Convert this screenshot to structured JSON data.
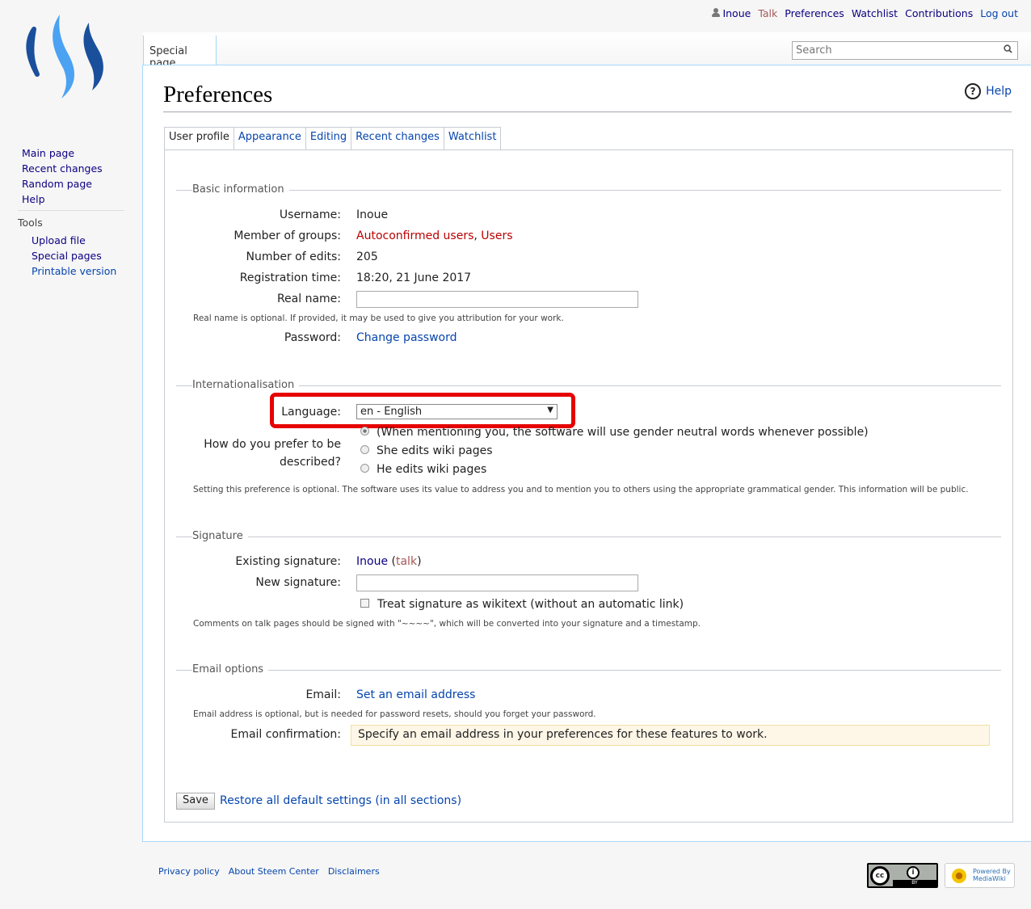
{
  "personal": {
    "username": "Inoue",
    "talk": "Talk",
    "preferences": "Preferences",
    "watchlist": "Watchlist",
    "contributions": "Contributions",
    "logout": "Log out"
  },
  "header": {
    "namespace_tab": "Special page",
    "search_placeholder": "Search"
  },
  "sidebar": {
    "nav": [
      "Main page",
      "Recent changes",
      "Random page",
      "Help"
    ],
    "tools_heading": "Tools",
    "tools": [
      "Upload file",
      "Special pages",
      "Printable version"
    ]
  },
  "page": {
    "title": "Preferences",
    "help": "Help"
  },
  "tabs": [
    "User profile",
    "Appearance",
    "Editing",
    "Recent changes",
    "Watchlist"
  ],
  "basic": {
    "legend": "Basic information",
    "username_label": "Username:",
    "username": "Inoue",
    "groups_label": "Member of groups:",
    "group1": "Autoconfirmed users",
    "sep": ", ",
    "group2": "Users",
    "edits_label": "Number of edits:",
    "edits": "205",
    "reg_label": "Registration time:",
    "reg": "18:20, 21 June 2017",
    "realname_label": "Real name:",
    "realname_value": "",
    "realname_help": "Real name is optional. If provided, it may be used to give you attribution for your work.",
    "password_label": "Password:",
    "password_link": "Change password"
  },
  "intl": {
    "legend": "Internationalisation",
    "language_label": "Language:",
    "language_value": "en - English",
    "gender_label_1": "How do you prefer to be",
    "gender_label_2": "described?",
    "gender_options": [
      "(When mentioning you, the software will use gender neutral words whenever possible)",
      "She edits wiki pages",
      "He edits wiki pages"
    ],
    "gender_selected": 0,
    "gender_help": "Setting this preference is optional. The software uses its value to address you and to mention you to others using the appropriate grammatical gender. This information will be public."
  },
  "signature": {
    "legend": "Signature",
    "existing_label": "Existing signature:",
    "existing_user": "Inoue",
    "existing_talk": "talk",
    "new_label": "New signature:",
    "new_value": "",
    "wikitext_label": "Treat signature as wikitext (without an automatic link)",
    "wikitext_checked": false,
    "help": "Comments on talk pages should be signed with \"~~~~\", which will be converted into your signature and a timestamp."
  },
  "email": {
    "legend": "Email options",
    "email_label": "Email:",
    "email_link": "Set an email address",
    "email_help": "Email address is optional, but is needed for password resets, should you forget your password.",
    "confirm_label": "Email confirmation:",
    "confirm_notice": "Specify an email address in your preferences for these features to work."
  },
  "actions": {
    "save": "Save",
    "restore": "Restore all default settings (in all sections)"
  },
  "footer": {
    "links": [
      "Privacy policy",
      "About Steem Center",
      "Disclaimers"
    ],
    "cc_badge": "BY",
    "mw_badge": "Powered By MediaWiki"
  },
  "colors": {
    "highlight": "#e60000",
    "link": "#0645ad",
    "new_link": "#ba0000",
    "notice_bg": "#fef6e7"
  }
}
